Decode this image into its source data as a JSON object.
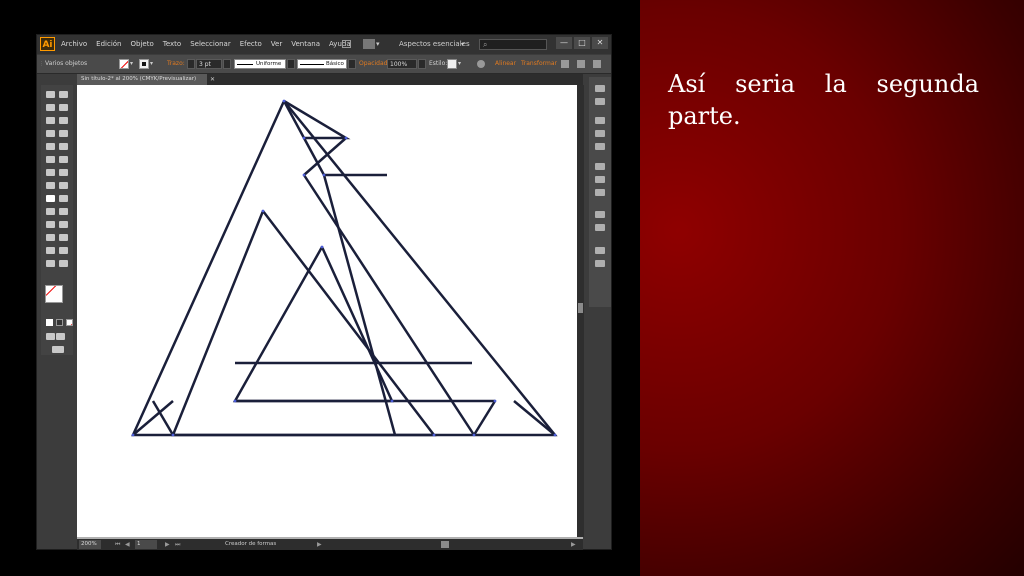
{
  "app": {
    "logo": "Ai",
    "menu": [
      "Archivo",
      "Edición",
      "Objeto",
      "Texto",
      "Seleccionar",
      "Efecto",
      "Ver",
      "Ventana",
      "Ayuda"
    ],
    "workspace": "Aspectos esenciales",
    "window_buttons": [
      "—",
      "□",
      "✕"
    ]
  },
  "control_bar": {
    "selection_label": "Varios objetos",
    "stroke_label": "Trazo:",
    "stroke_weight": "3 pt",
    "profile": "Uniforme",
    "brush": "Básico",
    "opacity_label": "Opacidad:",
    "opacity_value": "100%",
    "style_label": "Estilo:",
    "align_label": "Alinear",
    "transform_label": "Transformar"
  },
  "document": {
    "tab_title": "Sin título-2* al 200% (CMYK/Previsualizar)"
  },
  "status_bar": {
    "zoom": "200%",
    "page": "1",
    "status_text": "Creador de formas"
  },
  "slide": {
    "text": "Así seria la segunda parte."
  },
  "colors": {
    "slide_background": "#7a0000",
    "stroke": "#1a1f3a",
    "accent": "#e07a20"
  }
}
